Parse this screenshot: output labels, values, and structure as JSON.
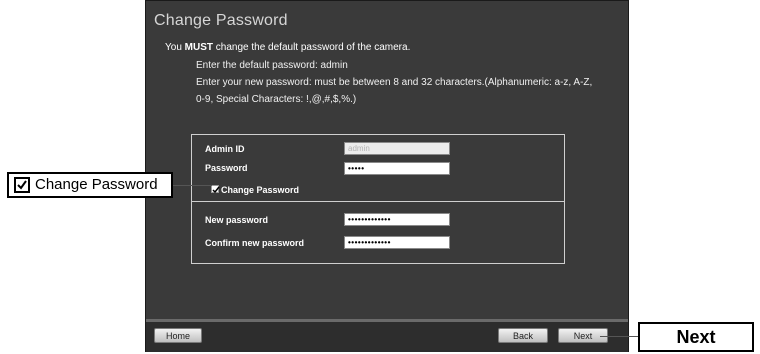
{
  "window": {
    "title": "Change Password",
    "intro_prefix": "You ",
    "intro_bold": "MUST",
    "intro_suffix": " change the default password of the camera.",
    "line1": "Enter the default password: admin",
    "line2": "Enter your new password: must be between 8 and 32 characters.(Alphanumeric: a-z, A-Z,",
    "line3": "0-9, Special Characters: !,@,#,$,%.)"
  },
  "form": {
    "admin_id_label": "Admin ID",
    "admin_id_value": "admin",
    "password_label": "Password",
    "password_value": "•••••",
    "change_password_checkbox_label": "Change Password",
    "change_password_checked": true,
    "new_password_label": "New password",
    "new_password_value": "•••••••••••••",
    "confirm_password_label": "Confirm new password",
    "confirm_password_value": "•••••••••••••"
  },
  "buttons": {
    "home": "Home",
    "back": "Back",
    "next": "Next"
  },
  "callouts": {
    "left": "Change Password",
    "right": "Next"
  }
}
